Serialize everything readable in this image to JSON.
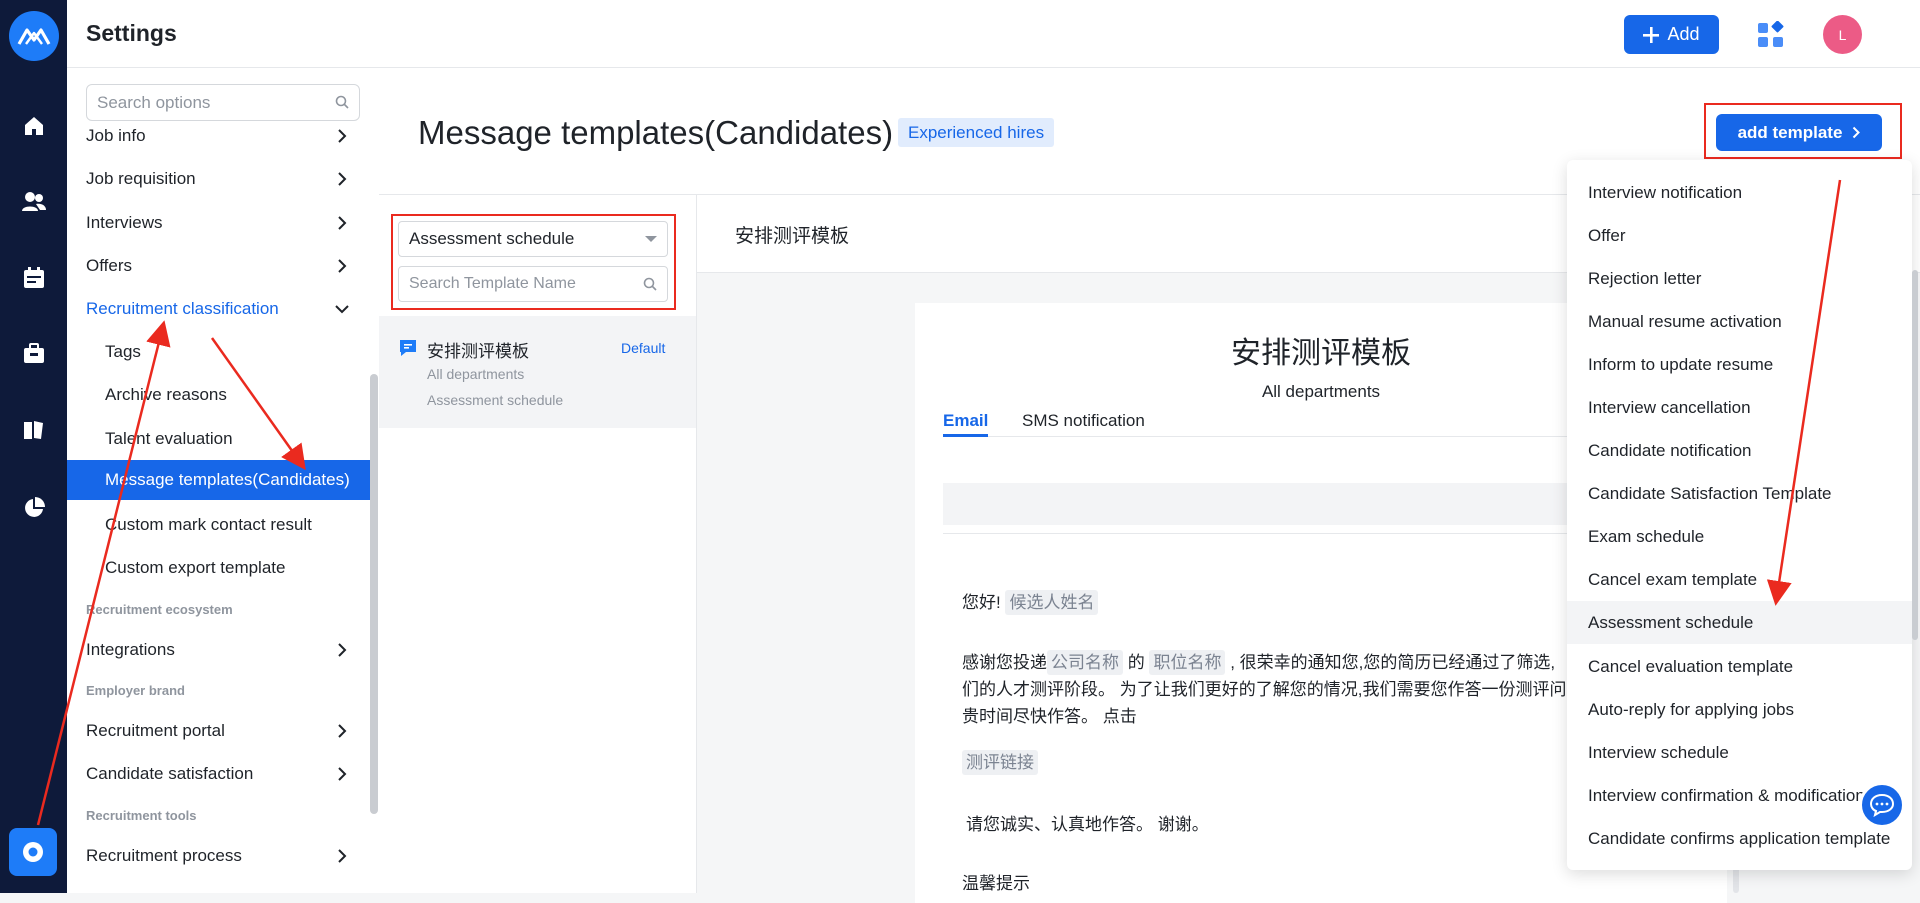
{
  "app": {
    "title": "Settings",
    "add_label": "Add",
    "avatar_letter": "L",
    "accent": "#1767e8"
  },
  "rail": {
    "icons": [
      "logo-icon",
      "home-icon",
      "users-icon",
      "calendar-icon",
      "briefcase-icon",
      "book-icon",
      "pie-chart-icon",
      "gear-icon"
    ]
  },
  "sidebar": {
    "search_placeholder": "Search options",
    "items": [
      {
        "label": "Job info"
      },
      {
        "label": "Job requisition"
      },
      {
        "label": "Interviews"
      },
      {
        "label": "Offers"
      },
      {
        "label": "Recruitment classification"
      },
      {
        "label": "Tags"
      },
      {
        "label": "Archive reasons"
      },
      {
        "label": "Talent evaluation"
      },
      {
        "label": "Message templates(Candidates)"
      },
      {
        "label": "Custom mark contact result"
      },
      {
        "label": "Custom export template"
      },
      {
        "label": "Integrations"
      },
      {
        "label": "Recruitment portal"
      },
      {
        "label": "Candidate satisfaction"
      },
      {
        "label": "Recruitment process"
      }
    ],
    "groups": [
      "Recruitment ecosystem",
      "Employer brand",
      "Recruitment tools"
    ]
  },
  "page": {
    "title": "Message templates(Candidates)",
    "tag": "Experienced hires",
    "add_template_label": "add template"
  },
  "filter": {
    "selected_type": "Assessment schedule",
    "search_placeholder": "Search Template Name"
  },
  "template_list": [
    {
      "name": "安排测评模板",
      "badge": "Default",
      "department": "All departments",
      "type": "Assessment schedule"
    }
  ],
  "detail": {
    "header_title": "安排测评模板",
    "card_title": "安排测评模板",
    "card_dept": "All departments",
    "tabs": [
      "Email",
      "SMS notification"
    ],
    "greeting": "您好!",
    "ph_candidate": "候选人姓名",
    "p1_a": "感谢您投递",
    "ph_company": "公司名称",
    "p1_b": "的",
    "ph_position": "职位名称",
    "p1_c": ", 很荣幸的通知您,您的简历已经通过了筛选,",
    "p1_line2": "们的人才测评阶段。 为了让我们更好的了解您的情况,我们需要您作答一份测评问",
    "p1_line3": "贵时间尽快作答。 点击",
    "ph_link": "测评链接",
    "p2": "请您诚实、认真地作答。 谢谢。",
    "p3": "温馨提示"
  },
  "dropdown": {
    "items": [
      "Interview notification",
      "Offer",
      "Rejection letter",
      "Manual resume activation",
      "Inform to update resume",
      "Interview cancellation",
      "Candidate notification",
      "Candidate Satisfaction Template",
      "Exam schedule",
      "Cancel exam template",
      "Assessment schedule",
      "Cancel evaluation template",
      "Auto-reply for applying jobs",
      "Interview schedule",
      "Interview confirmation & modification",
      "Candidate confirms application template"
    ],
    "highlighted": "Assessment schedule"
  },
  "annotation_color": "#ea2a1f"
}
